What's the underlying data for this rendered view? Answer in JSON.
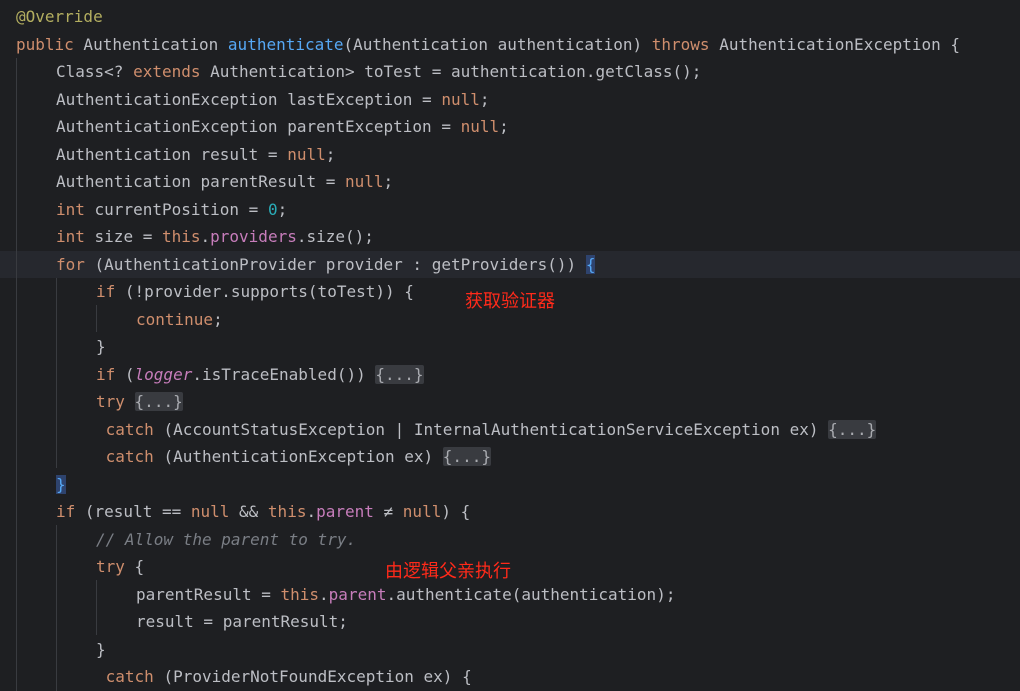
{
  "editor": {
    "language": "Java",
    "colors": {
      "background": "#1e1f22",
      "current_line": "#26282e",
      "keyword": "#cf8e6d",
      "annotation": "#b3ae60",
      "method_declaration": "#56a8f5",
      "number": "#2aacb8",
      "field": "#c77dbb",
      "comment": "#7a7e85",
      "default_text": "#bcbec4",
      "note_text": "#ff2a1a"
    },
    "lines": [
      {
        "indent": 0,
        "tokens": [
          [
            "t-annotation",
            "@Override"
          ]
        ]
      },
      {
        "indent": 0,
        "tokens": [
          [
            "t-keyword",
            "public"
          ],
          [
            "t-plain",
            " Authentication "
          ],
          [
            "t-method-decl",
            "authenticate"
          ],
          [
            "t-plain",
            "(Authentication authentication) "
          ],
          [
            "t-keyword",
            "throws"
          ],
          [
            "t-plain",
            " AuthenticationException {"
          ]
        ]
      },
      {
        "indent": 1,
        "tokens": [
          [
            "t-plain",
            "Class<? "
          ],
          [
            "t-keyword",
            "extends"
          ],
          [
            "t-plain",
            " Authentication> toTest = authentication.getClass();"
          ]
        ]
      },
      {
        "indent": 1,
        "tokens": [
          [
            "t-plain",
            "AuthenticationException lastException = "
          ],
          [
            "t-keyword",
            "null"
          ],
          [
            "t-plain",
            ";"
          ]
        ]
      },
      {
        "indent": 1,
        "tokens": [
          [
            "t-plain",
            "AuthenticationException parentException = "
          ],
          [
            "t-keyword",
            "null"
          ],
          [
            "t-plain",
            ";"
          ]
        ]
      },
      {
        "indent": 1,
        "tokens": [
          [
            "t-plain",
            "Authentication result = "
          ],
          [
            "t-keyword",
            "null"
          ],
          [
            "t-plain",
            ";"
          ]
        ]
      },
      {
        "indent": 1,
        "tokens": [
          [
            "t-plain",
            "Authentication parentResult = "
          ],
          [
            "t-keyword",
            "null"
          ],
          [
            "t-plain",
            ";"
          ]
        ]
      },
      {
        "indent": 1,
        "tokens": [
          [
            "t-keyword",
            "int"
          ],
          [
            "t-plain",
            " currentPosition = "
          ],
          [
            "t-number",
            "0"
          ],
          [
            "t-plain",
            ";"
          ]
        ]
      },
      {
        "indent": 1,
        "tokens": [
          [
            "t-keyword",
            "int"
          ],
          [
            "t-plain",
            " size = "
          ],
          [
            "t-keyword",
            "this"
          ],
          [
            "t-plain",
            "."
          ],
          [
            "t-field",
            "providers"
          ],
          [
            "t-plain",
            ".size();"
          ]
        ]
      },
      {
        "indent": 1,
        "current": true,
        "tokens": [
          [
            "t-keyword",
            "for"
          ],
          [
            "t-plain",
            " (AuthenticationProvider provider : getProviders()) "
          ],
          [
            "t-brace-strong",
            "{"
          ]
        ]
      },
      {
        "indent": 2,
        "tokens": [
          [
            "t-keyword",
            "if"
          ],
          [
            "t-plain",
            " (!provider.supports(toTest)) {"
          ]
        ]
      },
      {
        "indent": 3,
        "tokens": [
          [
            "t-keyword",
            "continue"
          ],
          [
            "t-plain",
            ";"
          ]
        ]
      },
      {
        "indent": 2,
        "tokens": [
          [
            "t-plain",
            "}"
          ]
        ]
      },
      {
        "indent": 2,
        "tokens": [
          [
            "t-keyword",
            "if"
          ],
          [
            "t-plain",
            " ("
          ],
          [
            "t-static",
            "logger"
          ],
          [
            "t-plain",
            ".isTraceEnabled()) "
          ],
          [
            "t-fold",
            "{...}"
          ]
        ]
      },
      {
        "indent": 2,
        "tokens": [
          [
            "t-keyword",
            "try"
          ],
          [
            "t-plain",
            " "
          ],
          [
            "t-fold",
            "{...}"
          ]
        ]
      },
      {
        "indent": 2,
        "tokens": [
          [
            "t-plain",
            " "
          ],
          [
            "t-keyword",
            "catch"
          ],
          [
            "t-plain",
            " (AccountStatusException | InternalAuthenticationServiceException ex) "
          ],
          [
            "t-fold",
            "{...}"
          ]
        ]
      },
      {
        "indent": 2,
        "tokens": [
          [
            "t-plain",
            " "
          ],
          [
            "t-keyword",
            "catch"
          ],
          [
            "t-plain",
            " (AuthenticationException ex) "
          ],
          [
            "t-fold",
            "{...}"
          ]
        ]
      },
      {
        "indent": 1,
        "tokens": [
          [
            "t-brace-strong",
            "}"
          ]
        ]
      },
      {
        "indent": 1,
        "tokens": [
          [
            "t-keyword",
            "if"
          ],
          [
            "t-plain",
            " (result == "
          ],
          [
            "t-keyword",
            "null"
          ],
          [
            "t-plain",
            " && "
          ],
          [
            "t-keyword",
            "this"
          ],
          [
            "t-plain",
            "."
          ],
          [
            "t-field",
            "parent"
          ],
          [
            "t-plain",
            " ≠ "
          ],
          [
            "t-keyword",
            "null"
          ],
          [
            "t-plain",
            ") {"
          ]
        ]
      },
      {
        "indent": 2,
        "tokens": [
          [
            "t-comment",
            "// Allow the parent to try."
          ]
        ]
      },
      {
        "indent": 2,
        "tokens": [
          [
            "t-keyword",
            "try"
          ],
          [
            "t-plain",
            " {"
          ]
        ]
      },
      {
        "indent": 3,
        "tokens": [
          [
            "t-plain",
            "parentResult = "
          ],
          [
            "t-keyword",
            "this"
          ],
          [
            "t-plain",
            "."
          ],
          [
            "t-field",
            "parent"
          ],
          [
            "t-plain",
            ".authenticate(authentication);"
          ]
        ]
      },
      {
        "indent": 3,
        "tokens": [
          [
            "t-plain",
            "result = parentResult;"
          ]
        ]
      },
      {
        "indent": 2,
        "tokens": [
          [
            "t-plain",
            "}"
          ]
        ]
      },
      {
        "indent": 2,
        "tokens": [
          [
            "t-plain",
            " "
          ],
          [
            "t-keyword",
            "catch"
          ],
          [
            "t-plain",
            " (ProviderNotFoundException ex) {"
          ]
        ]
      }
    ]
  },
  "notes": {
    "get_validator": "获取验证器",
    "parent_execute": "由逻辑父亲执行"
  }
}
